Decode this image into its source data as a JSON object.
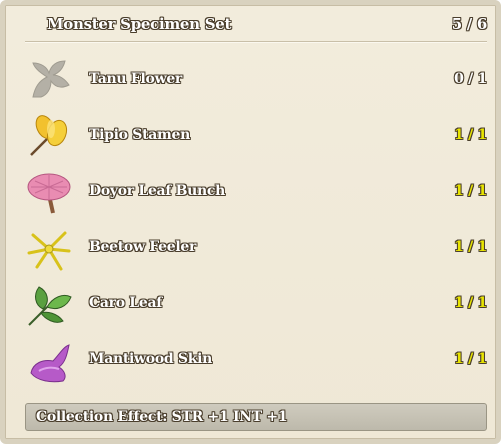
{
  "header": {
    "title": "Monster Specimen Set",
    "count": "5 / 6"
  },
  "items": [
    {
      "name": "Tanu Flower",
      "count": "0 / 1",
      "icon": "tanu-flower-icon",
      "collected": false
    },
    {
      "name": "Tipio Stamen",
      "count": "1 / 1",
      "icon": "tipio-stamen-icon",
      "collected": true
    },
    {
      "name": "Doyor Leaf Bunch",
      "count": "1 / 1",
      "icon": "doyor-leaf-bunch-icon",
      "collected": true
    },
    {
      "name": "Beetow Feeler",
      "count": "1 / 1",
      "icon": "beetow-feeler-icon",
      "collected": true
    },
    {
      "name": "Caro Leaf",
      "count": "1 / 1",
      "icon": "caro-leaf-icon",
      "collected": true
    },
    {
      "name": "Mantiwood Skin",
      "count": "1 / 1",
      "icon": "mantiwood-skin-icon",
      "collected": true
    }
  ],
  "effect": {
    "text": "Collection Effect: STR +1 INT +1"
  },
  "colors": {
    "panel_bg": "#efe8d6",
    "completed_count": "#e8e400",
    "text_outline": "#4a3e2c"
  }
}
